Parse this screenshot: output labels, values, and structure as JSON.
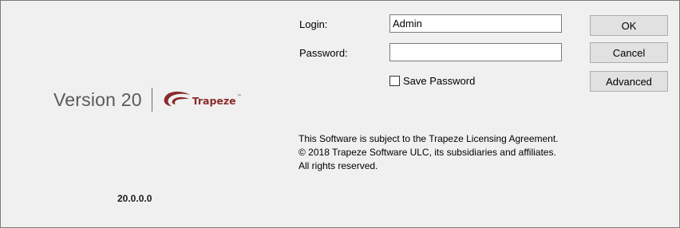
{
  "branding": {
    "version_label": "Version 20",
    "logo_text": "Trapeze",
    "trademark": "™",
    "logo_color": "#8a2b2b"
  },
  "build_version": "20.0.0.0",
  "form": {
    "login_label": "Login:",
    "login_value": "Admin",
    "password_label": "Password:",
    "password_value": "",
    "save_password_label": "Save Password",
    "save_password_checked": false
  },
  "buttons": {
    "ok": "OK",
    "cancel": "Cancel",
    "advanced": "Advanced"
  },
  "legal": {
    "line1": "This Software is subject to the Trapeze Licensing Agreement.",
    "line2": "© 2018 Trapeze Software ULC, its subsidiaries and affiliates.",
    "line3": "All rights reserved."
  }
}
